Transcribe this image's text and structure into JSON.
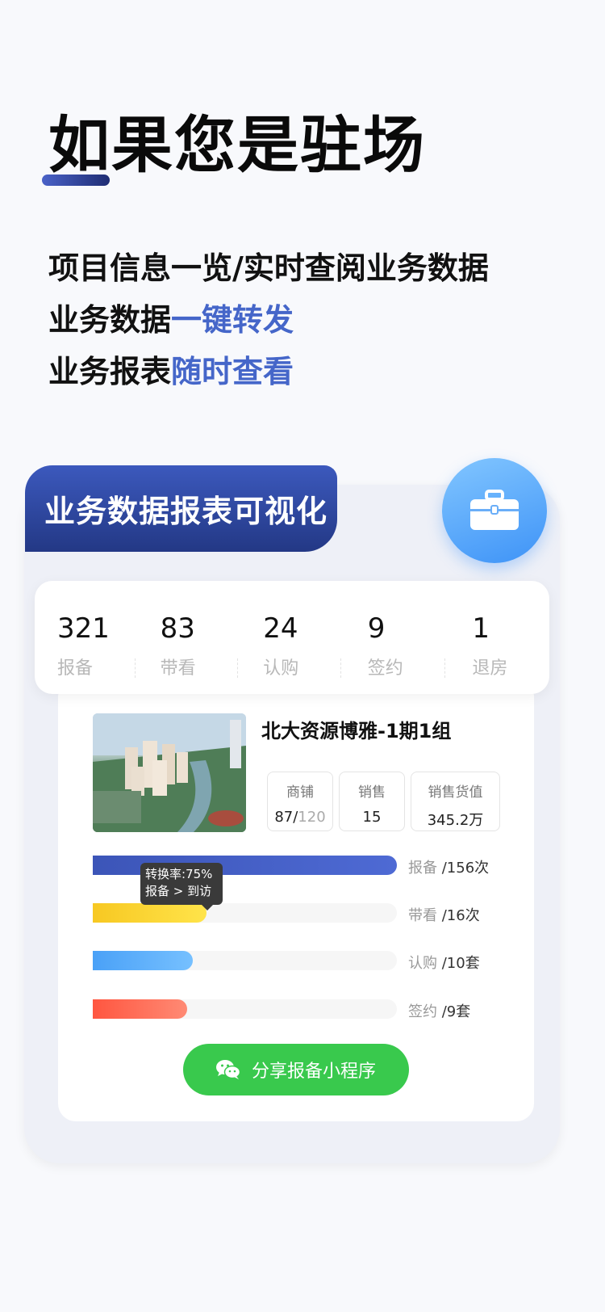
{
  "headline": "如果您是驻场",
  "lines": [
    {
      "text": "项目信息一览/实时查阅业务数据",
      "highlight": ""
    },
    {
      "text": "业务数据",
      "highlight": "一键转发"
    },
    {
      "text": "业务报表",
      "highlight": "随时查看"
    }
  ],
  "card": {
    "banner_title": "业务数据报表可视化",
    "fab_icon": "briefcase-icon",
    "stats": [
      {
        "value": "321",
        "label": "报备"
      },
      {
        "value": "83",
        "label": "带看"
      },
      {
        "value": "24",
        "label": "认购"
      },
      {
        "value": "9",
        "label": "签约"
      },
      {
        "value": "1",
        "label": "退房"
      }
    ],
    "project": {
      "title": "北大资源博雅-1期1组",
      "shop_label": "商铺",
      "shop_sold": "87/",
      "shop_total": "120",
      "sales_label": "销售",
      "sales_value": "15",
      "amount_label": "销售货值",
      "amount_value": "345.2万"
    },
    "bars": [
      {
        "label": "报备",
        "value": "/156次",
        "level": 1.0,
        "color": "blue"
      },
      {
        "label": "带看",
        "value": "/16次",
        "level": 0.375,
        "color": "yellow"
      },
      {
        "label": "认购",
        "value": "/10套",
        "level": 0.33,
        "color": "sky"
      },
      {
        "label": "签约",
        "value": "/9套",
        "level": 0.31,
        "color": "red"
      }
    ],
    "tooltip": {
      "line1": "转换率:75%",
      "line2": "报备 > 到访"
    },
    "share_button": "分享报备小程序",
    "share_icon": "wechat-icon"
  }
}
